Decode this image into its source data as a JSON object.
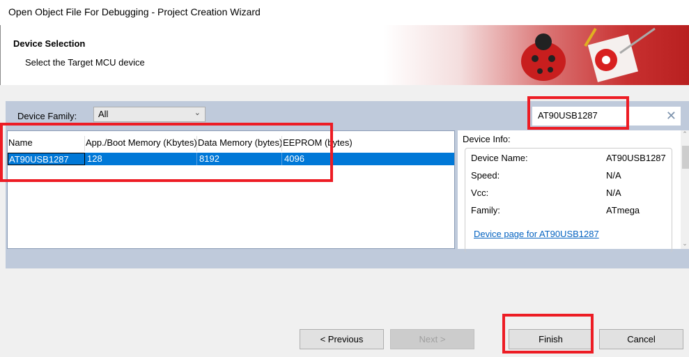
{
  "window": {
    "title": "Open Object File For Debugging  -  Project Creation Wizard"
  },
  "header": {
    "title": "Device Selection",
    "subtitle": "Select the Target MCU device"
  },
  "filter": {
    "family_label": "Device Family:",
    "family_value": "All",
    "search_value": "AT90USB1287"
  },
  "table": {
    "columns": [
      "Name",
      "App./Boot Memory (Kbytes)",
      "Data Memory (bytes)",
      "EEPROM (bytes)"
    ],
    "rows": [
      [
        "AT90USB1287",
        "128",
        "8192",
        "4096"
      ]
    ]
  },
  "device_info": {
    "title": "Device Info:",
    "fields": [
      {
        "label": "Device Name:",
        "value": "AT90USB1287"
      },
      {
        "label": "Speed:",
        "value": "N/A"
      },
      {
        "label": "Vcc:",
        "value": "N/A"
      },
      {
        "label": "Family:",
        "value": "ATmega"
      }
    ],
    "link": "Device page for AT90USB1287"
  },
  "buttons": {
    "previous": "< Previous",
    "next": "Next >",
    "finish": "Finish",
    "cancel": "Cancel"
  },
  "colors": {
    "selection": "#0078d7",
    "annotation": "#ed1c24",
    "panel": "#bfcadb"
  }
}
